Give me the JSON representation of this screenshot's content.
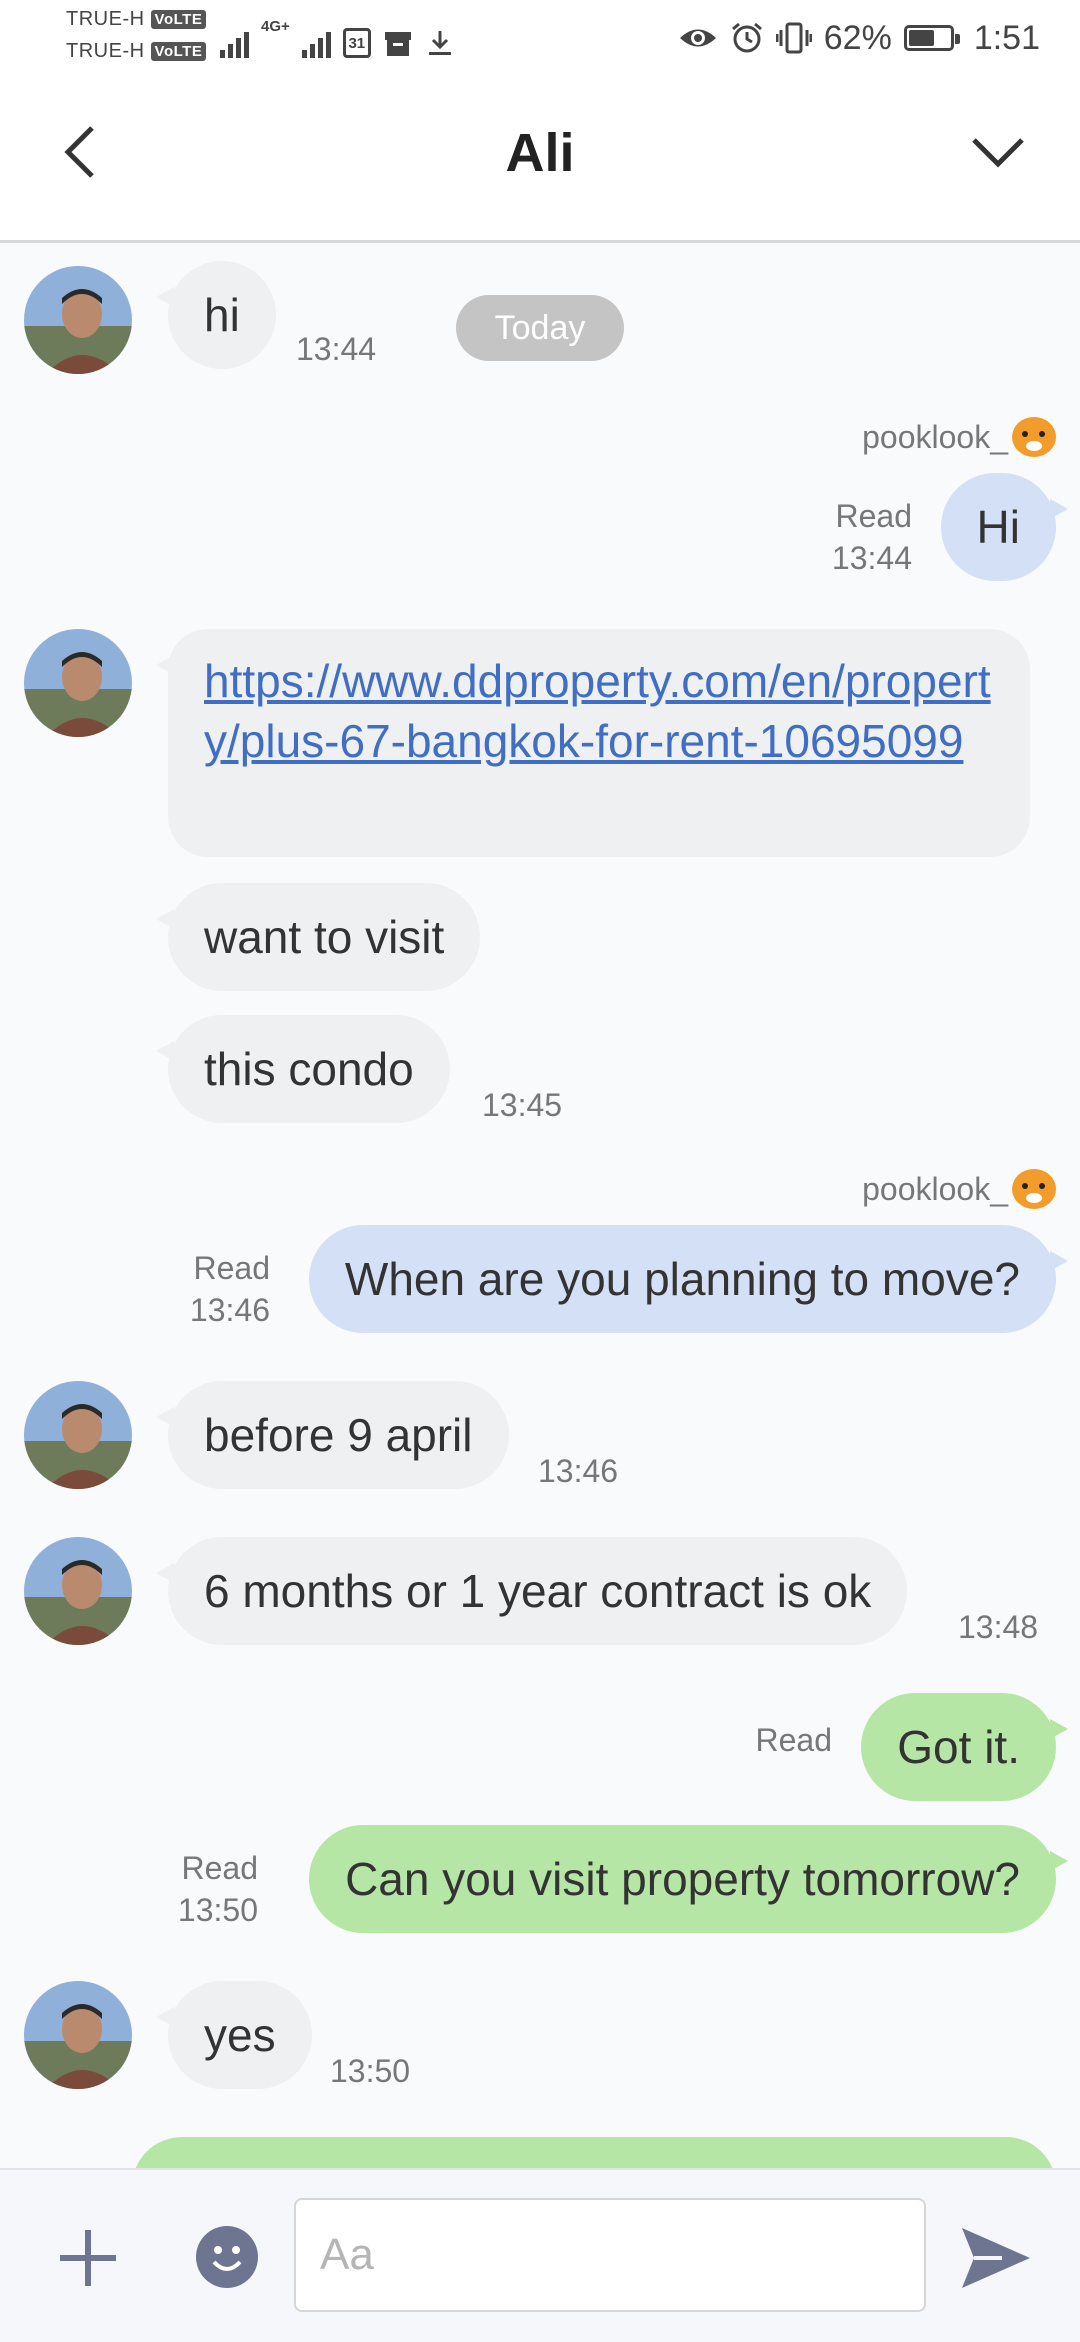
{
  "status_bar": {
    "carrier1": "TRUE-H",
    "carrier2": "TRUE-H",
    "volte": "VoLTE",
    "net_type": "4G+",
    "calendar_day": "31",
    "battery": "62%",
    "time": "1:51"
  },
  "header": {
    "title": "Ali"
  },
  "chat": {
    "date_divider": "Today",
    "messages": [
      {
        "text": "hi",
        "time": "13:44"
      },
      {
        "sender": "pooklook_",
        "text": "Hi",
        "read": "Read",
        "time": "13:44"
      },
      {
        "text": "https://www.ddproperty.com/en/property/plus-67-bangkok-for-rent-10695099"
      },
      {
        "text": "want to visit"
      },
      {
        "text": "this condo",
        "time": "13:45"
      },
      {
        "sender": "pooklook_",
        "text": "When are you planning to move?",
        "read": "Read",
        "time": "13:46"
      },
      {
        "text": "before 9 april",
        "time": "13:46"
      },
      {
        "text": "6 months or 1 year contract is ok",
        "time": "13:48"
      },
      {
        "text": "Got it.",
        "read": "Read"
      },
      {
        "text": "Can you visit property tomorrow?",
        "read": "Read",
        "time": "13:50"
      },
      {
        "text": "yes",
        "time": "13:50"
      }
    ]
  },
  "input": {
    "placeholder": "Aa"
  },
  "colors": {
    "incoming_bubble": "#eff0f2",
    "outgoing_blue": "#d4e0f5",
    "outgoing_green": "#b6e6a6",
    "link": "#3f6ec4"
  }
}
